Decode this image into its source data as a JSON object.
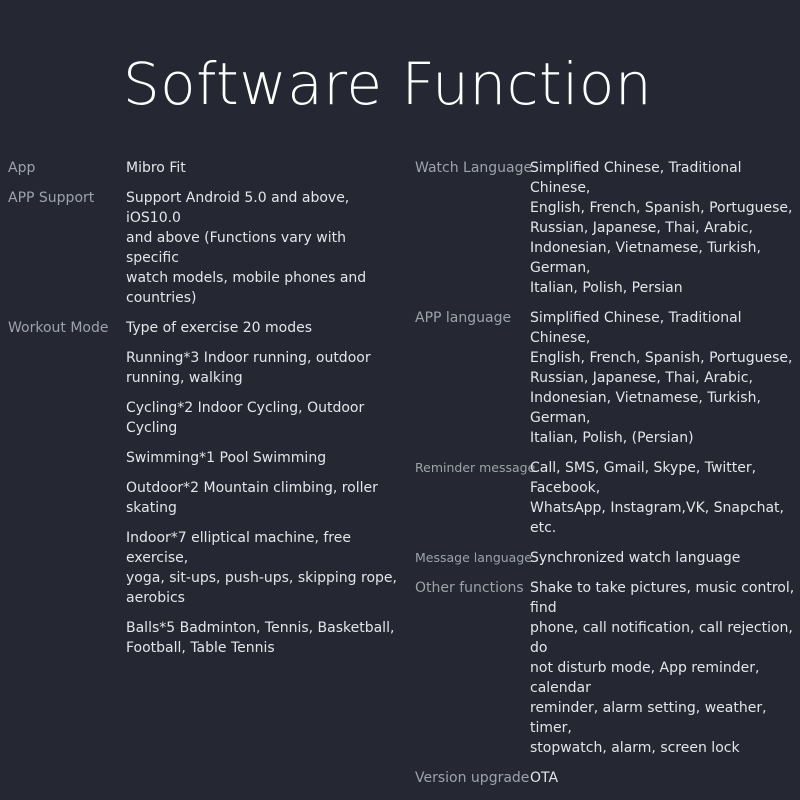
{
  "title": "Software Function",
  "left": {
    "app": {
      "label": "App",
      "value": "Mibro Fit"
    },
    "support": {
      "label": "APP Support",
      "lines": [
        "Support Android 5.0 and above, iOS10.0",
        "and above (Functions vary with specific",
        "watch models, mobile phones and",
        "countries)"
      ]
    },
    "workout": {
      "label": "Workout Mode",
      "items": [
        {
          "lines": [
            "Type of exercise  20 modes"
          ]
        },
        {
          "lines": [
            "Running*3   Indoor running, outdoor",
            "running, walking"
          ]
        },
        {
          "lines": [
            "Cycling*2   Indoor Cycling, Outdoor Cycling"
          ]
        },
        {
          "lines": [
            "Swimming*1   Pool Swimming"
          ]
        },
        {
          "lines": [
            "Outdoor*2   Mountain climbing, roller",
            "skating"
          ]
        },
        {
          "lines": [
            "Indoor*7   elliptical machine, free exercise,",
            "yoga, sit-ups, push-ups, skipping rope,",
            "aerobics"
          ]
        },
        {
          "lines": [
            "Balls*5   Badminton, Tennis, Basketball,",
            "Football, Table Tennis"
          ]
        }
      ]
    }
  },
  "right": {
    "watch_language": {
      "label": "Watch Language",
      "lines": [
        "Simplified Chinese, Traditional Chinese,",
        "English, French, Spanish, Portuguese,",
        "Russian, Japanese, Thai, Arabic,",
        "Indonesian, Vietnamese, Turkish, German,",
        "Italian, Polish, Persian"
      ]
    },
    "app_language": {
      "label": "APP language",
      "lines": [
        "Simplified Chinese, Traditional Chinese,",
        "English, French, Spanish, Portuguese,",
        "Russian, Japanese, Thai, Arabic,",
        "Indonesian, Vietnamese, Turkish, German,",
        "Italian, Polish, (Persian)"
      ]
    },
    "reminder": {
      "label": "Reminder message",
      "lines": [
        "Call, SMS, Gmail, Skype, Twitter, Facebook,",
        "WhatsApp, Instagram,VK, Snapchat, etc."
      ]
    },
    "message_language": {
      "label": "Message language",
      "lines": [
        "Synchronized watch language"
      ]
    },
    "other": {
      "label": "Other functions",
      "lines": [
        "Shake to take pictures, music control, find",
        "phone, call notification, call rejection, do",
        "not disturb mode, App reminder, calendar",
        "reminder, alarm setting, weather, timer,",
        "stopwatch, alarm, screen lock"
      ]
    },
    "version": {
      "label": "Version upgrade",
      "lines": [
        "OTA"
      ]
    }
  }
}
